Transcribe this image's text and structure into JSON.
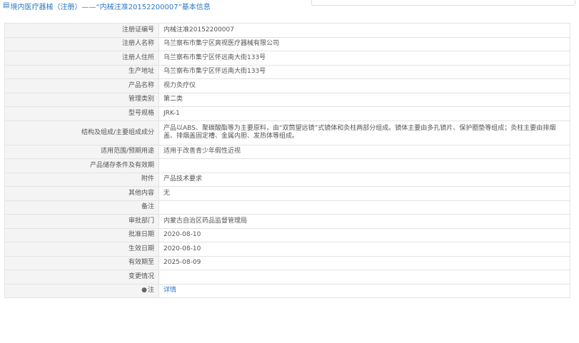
{
  "header": {
    "title": "境内医疗器械（注册）——“内械注准20152200007”基本信息",
    "icon": "document-icon",
    "accent_color": "#2b77c4"
  },
  "table": {
    "rows": [
      {
        "label": "注册证编号",
        "value": "内械注准20152200007"
      },
      {
        "label": "注册人名称",
        "value": "乌兰察布市集宁区爽视医疗器械有限公司"
      },
      {
        "label": "注册人住所",
        "value": "乌兰察布市集宁区怀远南大街133号"
      },
      {
        "label": "生产地址",
        "value": "乌兰察布市集宁区怀远南大街133号"
      },
      {
        "label": "产品名称",
        "value": "视力灸疗仪"
      },
      {
        "label": "管理类别",
        "value": "第二类"
      },
      {
        "label": "型号规格",
        "value": "JRK-1"
      },
      {
        "label": "结构及组成/主要组成成分",
        "value": "产品以ABS、聚碳酸酯等为主要原料，由“双筒望远镜”式镜体和灸柱两部分组成。镜体主要由多孔镜片、保护圈垫等组成；灸柱主要由排烟盖、排烟盖固定槽、金属内胆、发热体等组成。"
      },
      {
        "label": "适用范围/预期用途",
        "value": "适用于改善青少年假性近视"
      },
      {
        "label": "产品储存条件及有效期",
        "value": ""
      },
      {
        "label": "附件",
        "value": "产品技术要求"
      },
      {
        "label": "其他内容",
        "value": "无"
      },
      {
        "label": "备注",
        "value": ""
      },
      {
        "label": "审批部门",
        "value": "内蒙古自治区药品监督管理局"
      },
      {
        "label": "批准日期",
        "value": "2020-08-10"
      },
      {
        "label": "生效日期",
        "value": "2020-08-10"
      },
      {
        "label": "有效期至",
        "value": "2025-08-09"
      },
      {
        "label": "变更情况",
        "value": ""
      }
    ],
    "note": {
      "icon": "map-pin-icon",
      "label": "注",
      "link_text": "详情"
    }
  }
}
